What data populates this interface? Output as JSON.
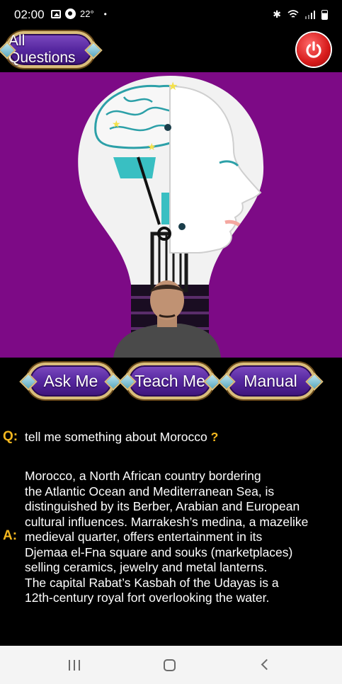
{
  "status_bar": {
    "time": "02:00",
    "temperature": "22°",
    "dot": "•"
  },
  "header": {
    "all_questions_label": "All Questions",
    "power_icon": "power-icon"
  },
  "hero": {
    "illustration": "ai-lightbulb-brain-head",
    "avatar": "person-photo"
  },
  "actions": {
    "ask_label": "Ask Me",
    "teach_label": "Teach Me",
    "manual_label": "Manual"
  },
  "conversation": {
    "q_label": "Q:",
    "question": "tell me something about Morocco",
    "question_mark": "?",
    "a_label": "A:",
    "answer_lines": [
      "Morocco, a North African country bordering",
      "the Atlantic Ocean and Mediterranean Sea, is",
      "distinguished by its Berber, Arabian and European",
      "cultural influences. Marrakesh’s medina, a mazelike",
      "medieval quarter, offers entertainment in its",
      "Djemaa el-Fna square and souks (marketplaces)",
      "selling ceramics, jewelry and metal lanterns.",
      "The capital Rabat’s Kasbah of the Udayas is a",
      "12th-century royal fort overlooking the water."
    ]
  },
  "colors": {
    "hero_background": "#7d0a86",
    "label_accent": "#f5b81f",
    "button_purple": "#5627a0",
    "button_border": "#d9bd7a",
    "power_red": "#d61a1a"
  }
}
